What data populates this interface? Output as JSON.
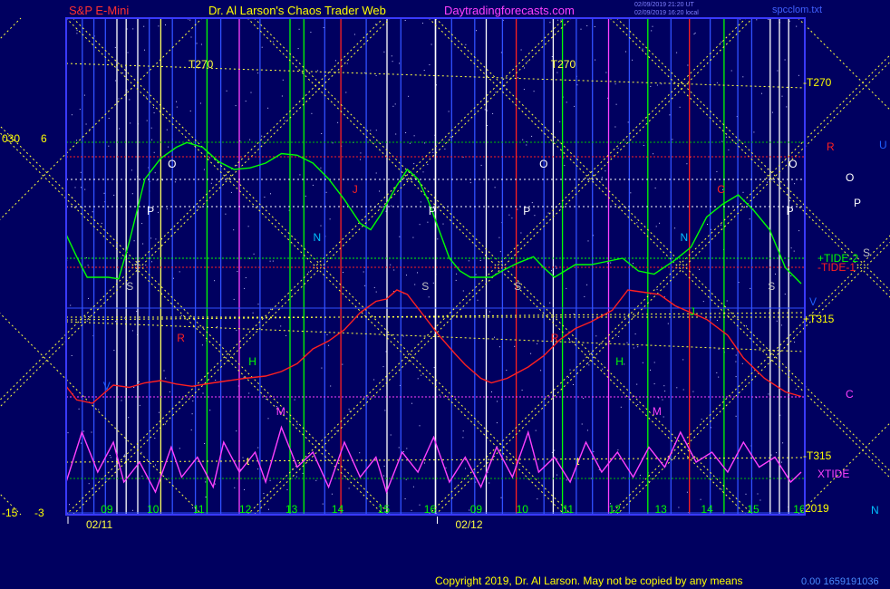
{
  "header": {
    "symbol": "S&P E-Mini",
    "title": "Dr. Al Larson's Chaos Trader Web",
    "site": "Daytradingforecasts.com",
    "stamp_line1": "02/09/2019 21:20 UT",
    "stamp_line2": "02/09/2019 16:20 local",
    "file": "spcclom.txt"
  },
  "left_axis": {
    "top_a": "030",
    "top_b": "6",
    "bottom_a": "-15",
    "bottom_b": "-3"
  },
  "right_labels": {
    "t270": "-T270",
    "r": "R",
    "u": "U",
    "o": "O",
    "p": "P",
    "s": "S",
    "tide2": "+TIDE-2",
    "tide1": "-TIDE-1",
    "v": "V",
    "t315p": "+T315",
    "c": "C",
    "t315m": "-T315",
    "xtide": "XTIDE",
    "year": "2019",
    "n": "N"
  },
  "footer": {
    "copyright": "Copyright 2019, Dr. Al Larson. May not be copied by any means",
    "code": "0.00 1659191036"
  },
  "chart_data": {
    "type": "line",
    "title": "S&P E-Mini",
    "x_days": [
      "02/11",
      "02/12"
    ],
    "hour_ticks": [
      "09",
      "10",
      "11",
      "12",
      "13",
      "14",
      "15",
      "16",
      "09",
      "10",
      "11",
      "12",
      "13",
      "14",
      "15",
      "16"
    ],
    "series": [
      {
        "name": "+TIDE-2",
        "color": "#00ff00",
        "points": [
          [
            0,
            35
          ],
          [
            0.2,
            21
          ],
          [
            0.4,
            8
          ],
          [
            0.6,
            8
          ],
          [
            0.8,
            8
          ],
          [
            1.0,
            7
          ],
          [
            1.2,
            30
          ],
          [
            1.5,
            70
          ],
          [
            1.8,
            83
          ],
          [
            2.1,
            90
          ],
          [
            2.3,
            93
          ],
          [
            2.6,
            90
          ],
          [
            2.9,
            81
          ],
          [
            3.2,
            76
          ],
          [
            3.5,
            77
          ],
          [
            3.8,
            80
          ],
          [
            4.1,
            86
          ],
          [
            4.4,
            85
          ],
          [
            4.7,
            80
          ],
          [
            5.0,
            70
          ],
          [
            5.3,
            57
          ],
          [
            5.6,
            42
          ],
          [
            5.8,
            38
          ],
          [
            6.0,
            48
          ],
          [
            6.3,
            66
          ],
          [
            6.5,
            76
          ],
          [
            6.7,
            70
          ],
          [
            6.9,
            56
          ],
          [
            7.1,
            38
          ],
          [
            7.3,
            20
          ],
          [
            7.5,
            12
          ],
          [
            7.7,
            8
          ],
          [
            7.9,
            8
          ],
          [
            8.1,
            8
          ],
          [
            8.3,
            12
          ],
          [
            8.6,
            17
          ],
          [
            8.9,
            21
          ],
          [
            9.1,
            14
          ],
          [
            9.3,
            8
          ],
          [
            9.5,
            12
          ],
          [
            9.7,
            16
          ],
          [
            10.0,
            16
          ],
          [
            10.3,
            18
          ],
          [
            10.6,
            20
          ],
          [
            10.9,
            12
          ],
          [
            11.2,
            10
          ],
          [
            11.6,
            19
          ],
          [
            11.9,
            27
          ],
          [
            12.2,
            46
          ],
          [
            12.5,
            54
          ],
          [
            12.8,
            60
          ],
          [
            13.1,
            50
          ],
          [
            13.4,
            38
          ],
          [
            13.7,
            14
          ],
          [
            14.0,
            4
          ]
        ]
      },
      {
        "name": "-TIDE-1",
        "color": "#ff2020",
        "points": [
          [
            0,
            15
          ],
          [
            0.2,
            3
          ],
          [
            0.5,
            0
          ],
          [
            0.9,
            16
          ],
          [
            1.2,
            14
          ],
          [
            1.5,
            18
          ],
          [
            1.8,
            20
          ],
          [
            2.1,
            17
          ],
          [
            2.4,
            15
          ],
          [
            2.8,
            18
          ],
          [
            3.1,
            20
          ],
          [
            3.4,
            22
          ],
          [
            3.8,
            24
          ],
          [
            4.1,
            28
          ],
          [
            4.4,
            35
          ],
          [
            4.7,
            48
          ],
          [
            5.0,
            55
          ],
          [
            5.3,
            65
          ],
          [
            5.6,
            80
          ],
          [
            5.9,
            90
          ],
          [
            6.1,
            92
          ],
          [
            6.3,
            100
          ],
          [
            6.5,
            96
          ],
          [
            6.8,
            78
          ],
          [
            7.1,
            60
          ],
          [
            7.4,
            44
          ],
          [
            7.6,
            34
          ],
          [
            7.9,
            22
          ],
          [
            8.1,
            18
          ],
          [
            8.4,
            22
          ],
          [
            8.8,
            32
          ],
          [
            9.1,
            42
          ],
          [
            9.4,
            56
          ],
          [
            9.7,
            66
          ],
          [
            10.0,
            72
          ],
          [
            10.4,
            82
          ],
          [
            10.7,
            100
          ],
          [
            11.0,
            98
          ],
          [
            11.3,
            96
          ],
          [
            11.6,
            86
          ],
          [
            11.9,
            80
          ],
          [
            12.2,
            74
          ],
          [
            12.6,
            60
          ],
          [
            12.9,
            40
          ],
          [
            13.3,
            22
          ],
          [
            13.7,
            10
          ],
          [
            14.0,
            6
          ]
        ]
      },
      {
        "name": "XTIDE",
        "color": "#ff40ff",
        "points": [
          [
            0,
            30
          ],
          [
            0.3,
            80
          ],
          [
            0.6,
            40
          ],
          [
            0.9,
            70
          ],
          [
            1.1,
            30
          ],
          [
            1.4,
            50
          ],
          [
            1.7,
            20
          ],
          [
            2.0,
            65
          ],
          [
            2.2,
            35
          ],
          [
            2.5,
            55
          ],
          [
            2.8,
            25
          ],
          [
            3.0,
            70
          ],
          [
            3.3,
            40
          ],
          [
            3.6,
            60
          ],
          [
            3.8,
            30
          ],
          [
            4.1,
            85
          ],
          [
            4.4,
            45
          ],
          [
            4.7,
            60
          ],
          [
            5.0,
            25
          ],
          [
            5.3,
            70
          ],
          [
            5.6,
            35
          ],
          [
            5.9,
            55
          ],
          [
            6.1,
            20
          ],
          [
            6.4,
            60
          ],
          [
            6.7,
            40
          ],
          [
            7.0,
            75
          ],
          [
            7.3,
            30
          ],
          [
            7.6,
            55
          ],
          [
            7.9,
            25
          ],
          [
            8.2,
            65
          ],
          [
            8.5,
            35
          ],
          [
            8.8,
            80
          ],
          [
            9.0,
            40
          ],
          [
            9.3,
            55
          ],
          [
            9.6,
            30
          ],
          [
            9.9,
            70
          ],
          [
            10.2,
            40
          ],
          [
            10.5,
            60
          ],
          [
            10.8,
            35
          ],
          [
            11.1,
            65
          ],
          [
            11.4,
            45
          ],
          [
            11.7,
            80
          ],
          [
            12.0,
            50
          ],
          [
            12.3,
            60
          ],
          [
            12.6,
            40
          ],
          [
            12.9,
            70
          ],
          [
            13.2,
            45
          ],
          [
            13.5,
            55
          ],
          [
            13.8,
            30
          ],
          [
            14.0,
            40
          ]
        ]
      }
    ]
  }
}
